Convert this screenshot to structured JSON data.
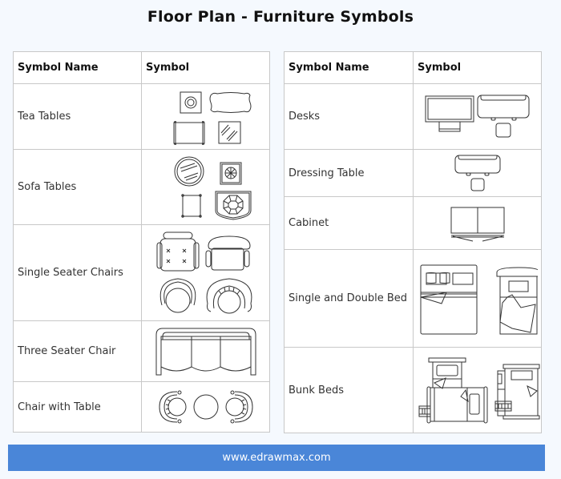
{
  "title": "Floor Plan - Furniture Symbols",
  "tables": [
    {
      "headers": {
        "name": "Symbol Name",
        "symbol": "Symbol"
      },
      "rows": [
        {
          "name": "Tea Tables",
          "symbol_icons": [
            "square-round-tea-table-icon",
            "scalloped-tea-table-icon",
            "rectangular-tea-table-icon",
            "glass-square-tea-table-icon"
          ]
        },
        {
          "name": "Sofa Tables",
          "symbol_icons": [
            "round-glass-sofa-table-icon",
            "square-wheel-sofa-table-icon",
            "small-square-sofa-table-icon",
            "octagon-sofa-table-icon"
          ]
        },
        {
          "name": "Single Seater Chairs",
          "symbol_icons": [
            "tufted-armchair-icon",
            "office-chair-icon",
            "round-armchair-icon",
            "scroll-armchair-icon"
          ]
        },
        {
          "name": "Three Seater Chair",
          "symbol_icons": [
            "three-seater-sofa-icon"
          ]
        },
        {
          "name": "Chair with Table",
          "symbol_icons": [
            "armchair-left-icon",
            "round-table-icon",
            "armchair-right-icon"
          ]
        }
      ]
    },
    {
      "headers": {
        "name": "Symbol Name",
        "symbol": "Symbol"
      },
      "rows": [
        {
          "name": "Desks",
          "symbol_icons": [
            "computer-desk-icon",
            "desk-with-stool-icon"
          ]
        },
        {
          "name": "Dressing Table",
          "symbol_icons": [
            "dressing-table-icon"
          ]
        },
        {
          "name": "Cabinet",
          "symbol_icons": [
            "cabinet-icon"
          ]
        },
        {
          "name": "Single and Double Bed",
          "symbol_icons": [
            "double-bed-icon",
            "single-bed-icon"
          ]
        },
        {
          "name": "Bunk Beds",
          "symbol_icons": [
            "bunk-bed-l-shaped-icon",
            "bunk-bed-stacked-icon"
          ]
        }
      ]
    }
  ],
  "footer": {
    "text": "www.edrawmax.com"
  },
  "colors": {
    "footer_bg": "#4a86d8",
    "page_bg": "#f5f9fe",
    "border": "#c8c8c8"
  }
}
